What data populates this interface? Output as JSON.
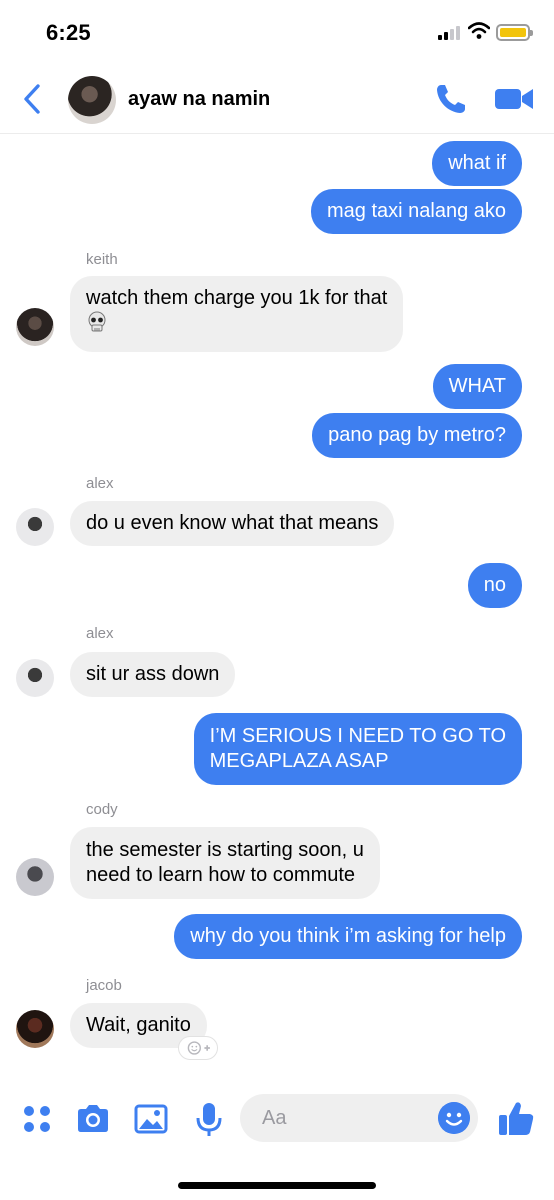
{
  "status_bar": {
    "time": "6:25"
  },
  "header": {
    "title": "ayaw na namin"
  },
  "colors": {
    "accent": "#3e7ff0",
    "incoming_bubble": "#efefef",
    "battery": "#f2c40c"
  },
  "messages": [
    {
      "side": "out",
      "text": "what if"
    },
    {
      "side": "out",
      "text": "mag taxi nalang ako"
    },
    {
      "side": "in",
      "sender": "keith",
      "text": "watch them charge you 1k for that"
    },
    {
      "side": "out",
      "text": "WHAT"
    },
    {
      "side": "out",
      "text": "pano pag by metro?"
    },
    {
      "side": "in",
      "sender": "alex",
      "text": "do u even know what that means"
    },
    {
      "side": "out",
      "text": "no"
    },
    {
      "side": "in",
      "sender": "alex",
      "text": "sit ur ass down"
    },
    {
      "side": "out",
      "lines": [
        "I’M SERIOUS I NEED TO GO TO",
        "MEGAPLAZA ASAP"
      ]
    },
    {
      "side": "in",
      "sender": "cody",
      "lines": [
        "the semester is starting soon, u",
        "need to learn how to commute"
      ]
    },
    {
      "side": "out",
      "text": "why do you think i’m asking for help"
    },
    {
      "side": "in",
      "sender": "jacob",
      "text": "Wait, ganito"
    }
  ],
  "icons": {
    "back": "chevron-left-icon",
    "call": "phone-icon",
    "video": "video-camera-icon",
    "skull": "skull-emoji-icon",
    "react": "add-reaction-icon",
    "more": "four-dots-icon",
    "camera": "camera-icon",
    "gallery": "image-icon",
    "mic": "microphone-icon",
    "emoji": "smiley-icon",
    "like": "thumbs-up-icon"
  },
  "composer": {
    "placeholder": "Aa"
  }
}
